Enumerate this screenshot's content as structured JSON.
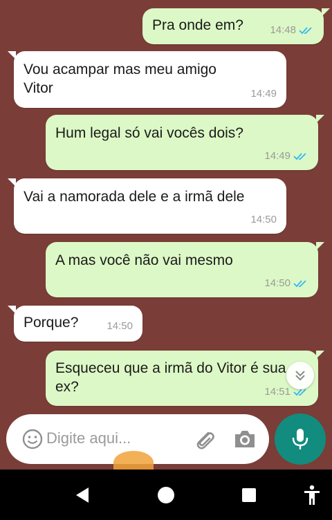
{
  "messages": [
    {
      "text": "Pra onde em?",
      "time": "14:48",
      "direction": "out",
      "read": true
    },
    {
      "text": "Vou acampar mas meu amigo Vitor",
      "time": "14:49",
      "direction": "in"
    },
    {
      "text": "Hum legal só vai vocês dois?",
      "time": "14:49",
      "direction": "out",
      "read": true
    },
    {
      "text": "Vai a namorada dele e a irmã dele",
      "time": "14:50",
      "direction": "in"
    },
    {
      "text": "A mas você não vai mesmo",
      "time": "14:50",
      "direction": "out",
      "read": true
    },
    {
      "text": "Porque?",
      "time": "14:50",
      "direction": "in"
    },
    {
      "text": "Esqueceu que a irmã do Vitor é sua ex?",
      "time": "14:51",
      "direction": "out",
      "read": true
    }
  ],
  "composer": {
    "placeholder": "Digite aqui..."
  },
  "icons": {
    "emoji": "emoji-icon",
    "attach": "paperclip-icon",
    "camera": "camera-icon",
    "mic": "microphone-icon",
    "scroll": "chevron-double-down-icon",
    "ticks": "double-check-icon",
    "nav_back": "triangle-back-icon",
    "nav_home": "circle-home-icon",
    "nav_recents": "square-recents-icon",
    "nav_accessibility": "accessibility-icon"
  },
  "colors": {
    "background": "#7a3d37",
    "outgoing_bubble": "#dcf8c6",
    "incoming_bubble": "#ffffff",
    "read_ticks": "#34b7f1",
    "mic_button": "#128c7e",
    "navbar": "#000000"
  }
}
